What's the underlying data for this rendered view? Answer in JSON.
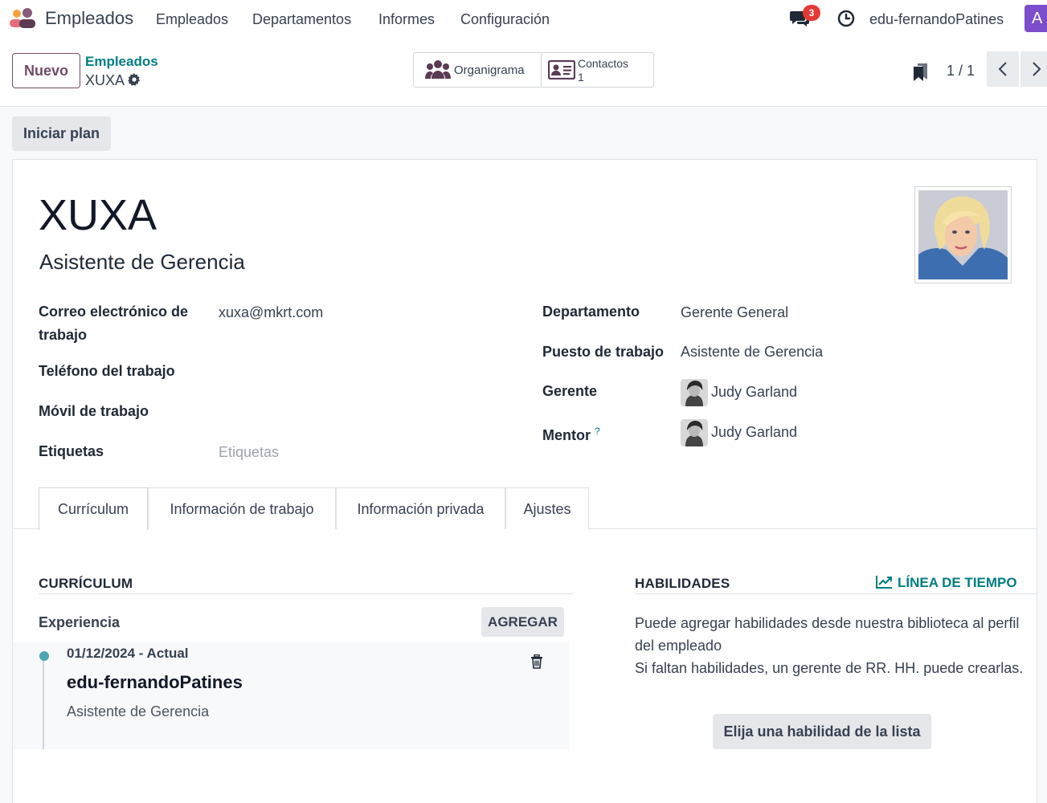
{
  "navbar": {
    "app_name": "Empleados",
    "menu": [
      "Empleados",
      "Departamentos",
      "Informes",
      "Configuración"
    ],
    "chat_badge": "3",
    "user": "edu-fernandoPatines",
    "avatar_letter": "A"
  },
  "control": {
    "new_label": "Nuevo",
    "breadcrumb_parent": "Empleados",
    "breadcrumb_current": "XUXA",
    "org_chart_label": "Organigrama",
    "contacts_label": "Contactos",
    "contacts_count": "1",
    "pager": "1 / 1"
  },
  "actions": {
    "start_plan": "Iniciar plan"
  },
  "employee": {
    "name": "XUXA",
    "job_title": "Asistente de Gerencia",
    "fields_left": [
      {
        "label": "Correo electrónico de trabajo",
        "value": "xuxa@mkrt.com"
      },
      {
        "label": "Teléfono del trabajo",
        "value": ""
      },
      {
        "label": "Móvil de trabajo",
        "value": ""
      },
      {
        "label": "Etiquetas",
        "placeholder": "Etiquetas"
      }
    ],
    "fields_right": [
      {
        "label": "Departamento",
        "value": "Gerente General"
      },
      {
        "label": "Puesto de trabajo",
        "value": "Asistente de Gerencia"
      },
      {
        "label": "Gerente",
        "value": "Judy Garland"
      },
      {
        "label": "Mentor",
        "value": "Judy Garland",
        "help": "?"
      }
    ]
  },
  "tabs": [
    "Currículum",
    "Información de trabajo",
    "Información privada",
    "Ajustes"
  ],
  "resume": {
    "title": "CURRÍCULUM",
    "experience_label": "Experiencia",
    "add_label": "AGREGAR",
    "entries": [
      {
        "date": "01/12/2024 - Actual",
        "name": "edu-fernandoPatines",
        "description": "Asistente de Gerencia"
      }
    ]
  },
  "skills": {
    "title": "HABILIDADES",
    "timeline_label": "LÍNEA DE TIEMPO",
    "text_1": "Puede agregar habilidades desde nuestra biblioteca al perfil del empleado",
    "text_2": "Si faltan habilidades, un gerente de RR. HH. puede crearlas.",
    "pick_label": "Elija una habilidad de la lista"
  },
  "colors": {
    "accent": "#714b67",
    "link": "#017e84",
    "badge": "#e53935",
    "avatar_bg": "#7c4dcc"
  }
}
